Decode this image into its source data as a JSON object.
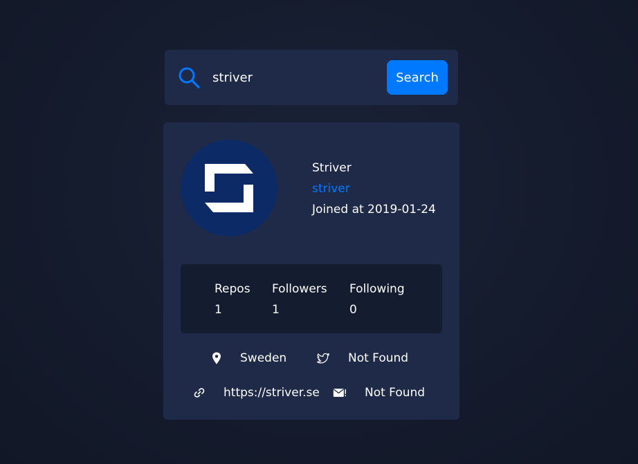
{
  "search": {
    "value": "striver",
    "button_label": "Search"
  },
  "profile": {
    "name": "Striver",
    "login": "striver",
    "joined": "Joined at 2019-01-24"
  },
  "stats": {
    "repos_label": "Repos",
    "repos_value": "1",
    "followers_label": "Followers",
    "followers_value": "1",
    "following_label": "Following",
    "following_value": "0"
  },
  "info": {
    "location": "Sweden",
    "twitter": "Not Found",
    "blog": "https://striver.se",
    "email": "Not Found"
  },
  "icons": {
    "search": "search-icon",
    "location": "map-pin-icon",
    "twitter": "twitter-icon",
    "blog": "link-icon",
    "email": "mail-icon"
  },
  "colors": {
    "background": "#141b2c",
    "card": "#1e2a47",
    "stats_box": "#141d2f",
    "accent": "#0079ff",
    "avatar_bg": "#0b2a66",
    "text": "#ffffff"
  }
}
